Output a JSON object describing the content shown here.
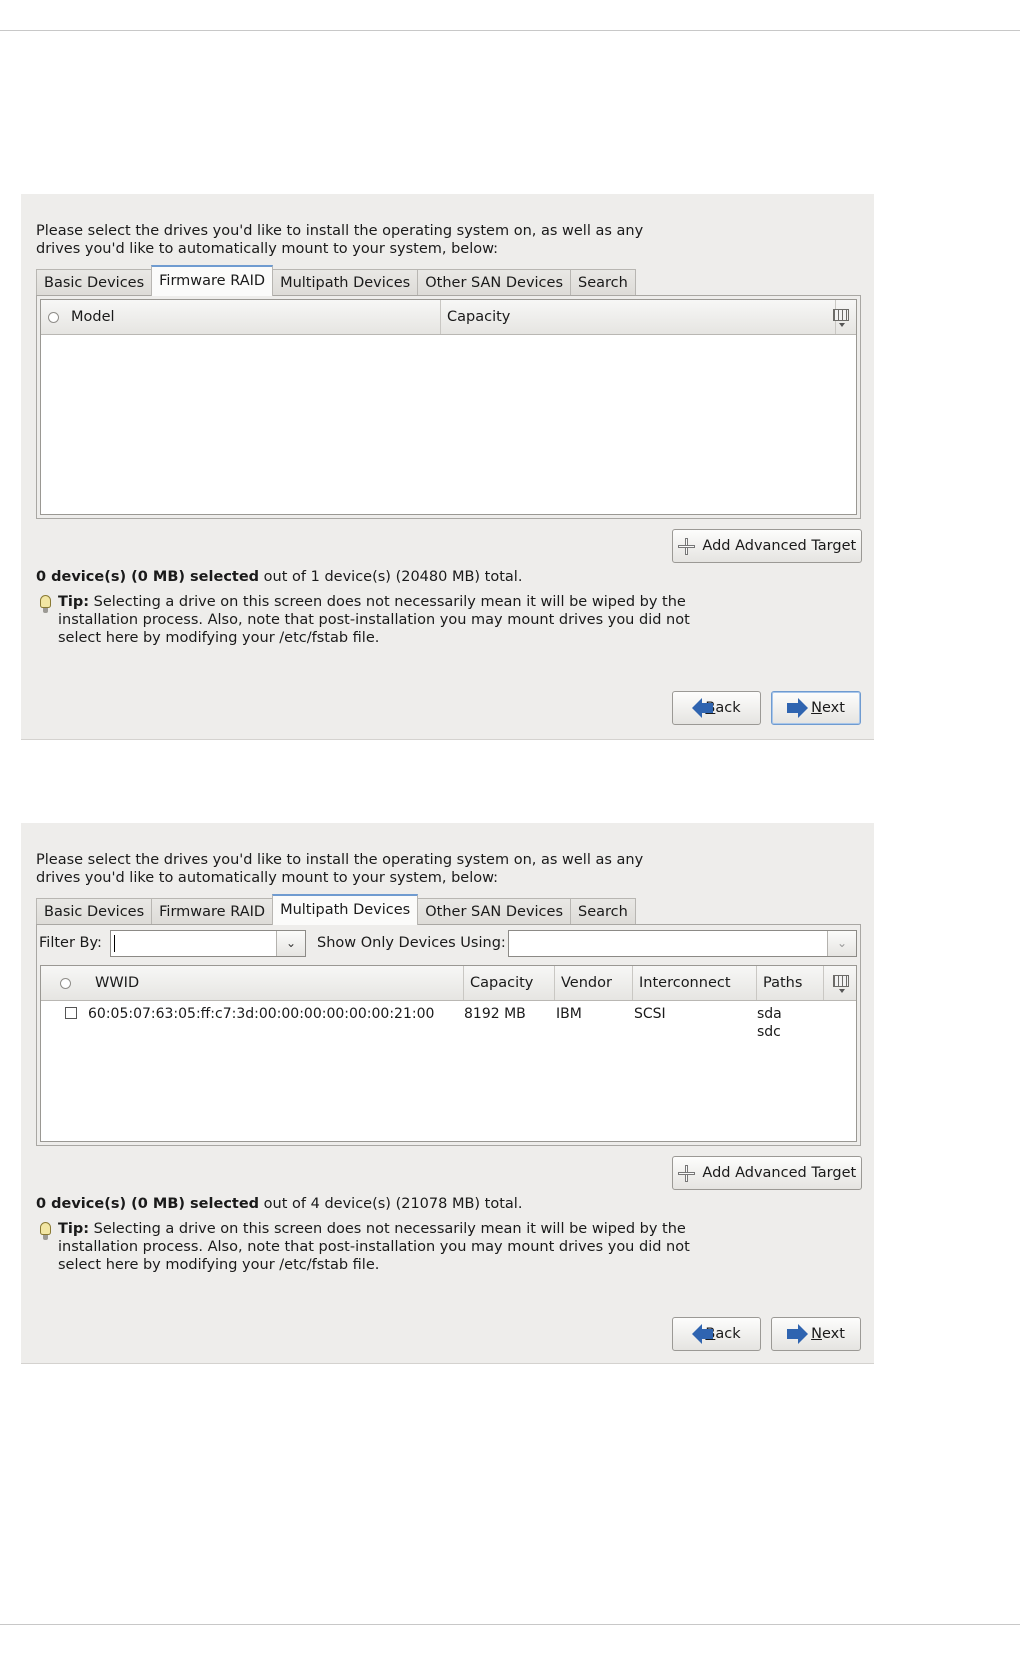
{
  "intro": {
    "line1": "Please select the drives you'd like to install the operating system on, as well as any",
    "line2": "drives you'd like to automatically mount to your system, below:"
  },
  "tabs": [
    "Basic Devices",
    "Firmware RAID",
    "Multipath Devices",
    "Other SAN Devices",
    "Search"
  ],
  "icons": {
    "header_radio": "radio-icon",
    "column_chooser": "column-chooser-icon",
    "add": "plus-icon",
    "back": "arrow-left-icon",
    "next": "arrow-right-icon",
    "tip": "lightbulb-icon",
    "dropdown": "chevron-down-icon"
  },
  "buttons": {
    "add_advanced_target": "Add Advanced Target",
    "back_mnemonic": "B",
    "back_rest": "ack",
    "next_mnemonic": "N",
    "next_rest": "ext"
  },
  "tip": {
    "label": "Tip:",
    "line1": "Selecting a drive on this screen does not necessarily mean it will be wiped by the",
    "line2": "installation process.  Also, note that post-installation you may mount drives you did not",
    "line3": "select here by modifying your /etc/fstab file."
  },
  "panel1": {
    "active_tab": "Firmware RAID",
    "columns": [
      "Model",
      "Capacity"
    ],
    "selected_summary": "0 device(s) (0 MB) selected",
    "total_summary": " out of 1 device(s) (20480 MB) total.",
    "focused_button": "Next"
  },
  "panel2": {
    "active_tab": "Multipath Devices",
    "filter_label": "Filter By:",
    "filter_value": "",
    "show_only_label": "Show Only Devices Using:",
    "show_only_value": "",
    "columns": [
      "WWID",
      "Capacity",
      "Vendor",
      "Interconnect",
      "Paths"
    ],
    "rows": [
      {
        "checked": false,
        "wwid": "60:05:07:63:05:ff:c7:3d:00:00:00:00:00:00:21:00",
        "capacity": "8192 MB",
        "vendor": "IBM",
        "interconnect": "SCSI",
        "paths_1": "sda",
        "paths_2": "sdc"
      }
    ],
    "selected_summary": "0 device(s) (0 MB) selected",
    "total_summary": " out of 4 device(s) (21078 MB) total."
  },
  "colors": {
    "panel_bg": "#eeedeb",
    "focus_blue": "#6f9bd0",
    "arrow_blue": "#2f64b0"
  }
}
